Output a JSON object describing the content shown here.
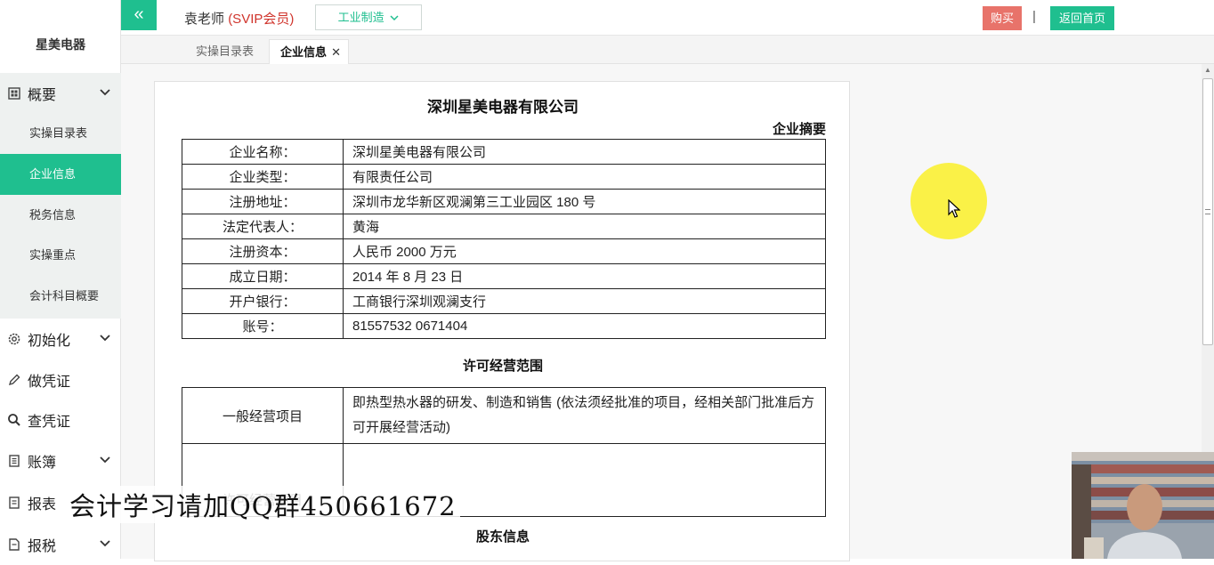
{
  "sidebar": {
    "brand": "星美电器",
    "groups": [
      {
        "label": "概要",
        "icon": "dashboard-icon",
        "expanded": true
      },
      {
        "label": "初始化",
        "icon": "gear-icon"
      },
      {
        "label": "做凭证",
        "icon": "pen-icon"
      },
      {
        "label": "查凭证",
        "icon": "search-icon"
      },
      {
        "label": "账簿",
        "icon": "book-icon"
      },
      {
        "label": "报表",
        "icon": "report-icon"
      },
      {
        "label": "报税",
        "icon": "tax-icon"
      }
    ],
    "sub_items": [
      {
        "label": "实操目录表"
      },
      {
        "label": "企业信息",
        "active": true
      },
      {
        "label": "税务信息"
      },
      {
        "label": "实操重点"
      },
      {
        "label": "会计科目概要"
      }
    ]
  },
  "topbar": {
    "collapse_icon": "«",
    "user_name": "袁老师",
    "user_level": "(SVIP会员)",
    "industry": "工业制造",
    "buy_label": "购买",
    "separator": "|",
    "home_label": "返回首页"
  },
  "tabs": [
    {
      "label": "实操目录表"
    },
    {
      "label": "企业信息",
      "active": true,
      "close": "✕"
    }
  ],
  "document": {
    "company_title": "深圳星美电器有限公司",
    "summary_label": "企业摘要",
    "info_rows": [
      {
        "key": "企业名称：",
        "value": "深圳星美电器有限公司"
      },
      {
        "key": "企业类型：",
        "value": "有限责任公司"
      },
      {
        "key": "注册地址：",
        "value": "深圳市龙华新区观澜第三工业园区 180 号"
      },
      {
        "key": "法定代表人：",
        "value": "黄海"
      },
      {
        "key": "注册资本：",
        "value": "人民币 2000 万元"
      },
      {
        "key": "成立日期：",
        "value": "2014 年 8 月 23 日"
      },
      {
        "key": "开户银行：",
        "value": "工商银行深圳观澜支行"
      },
      {
        "key": "账号：",
        "value": "81557532 0671404"
      }
    ],
    "scope_title": "许可经营范围",
    "scope_rows": [
      {
        "key": "一般经营项目",
        "value": "即热型热水器的研发、制造和销售 (依法须经批准的项目，经相关部门批准后方可开展经营活动)"
      },
      {
        "key": "许可经营项目",
        "value": ""
      }
    ],
    "shareholder_title": "股东信息"
  },
  "overlay": {
    "watermark": "会计学习请加QQ群450661672"
  },
  "colors": {
    "accent": "#1fbf8f",
    "buy": "#e8736a",
    "vip": "#d0342c",
    "cursor_highlight": "#faf028"
  }
}
